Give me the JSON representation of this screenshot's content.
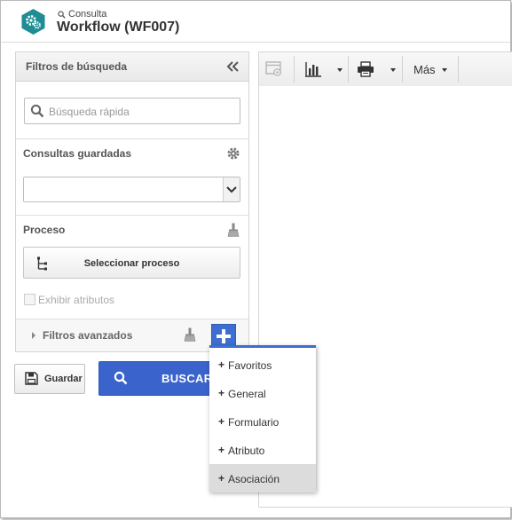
{
  "header": {
    "breadcrumb": "Consulta",
    "title": "Workflow (WF007)",
    "brand_color": "#1e8d94"
  },
  "filters": {
    "title": "Filtros de búsqueda",
    "quick_search_placeholder": "Búsqueda rápida",
    "saved_queries_label": "Consultas guardadas",
    "saved_queries_value": "",
    "process_label": "Proceso",
    "select_process_label": "Seleccionar proceso",
    "show_attributes_label": "Exhibir atributos",
    "advanced_filters_label": "Filtros avanzados"
  },
  "actions": {
    "save_label": "Guardar",
    "search_label": "BUSCAR",
    "accent_color": "#3b63cc"
  },
  "toolbar": {
    "more_label": "Más"
  },
  "add_menu": {
    "items": [
      {
        "label": "Favoritos"
      },
      {
        "label": "General"
      },
      {
        "label": "Formulario"
      },
      {
        "label": "Atributo"
      },
      {
        "label": "Asociación"
      }
    ]
  }
}
